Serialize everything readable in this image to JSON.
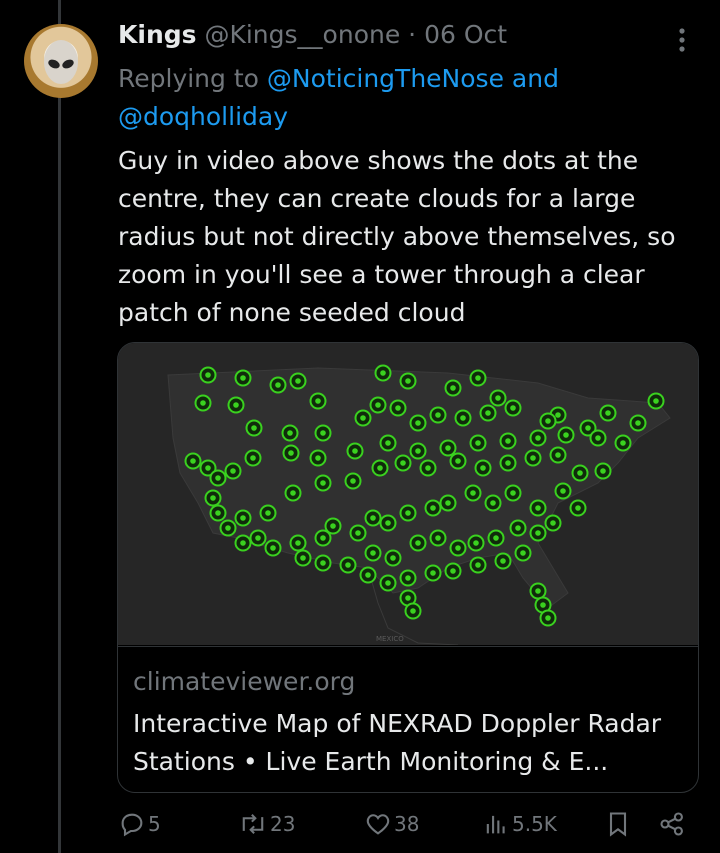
{
  "tweet": {
    "author_name": "Kings",
    "handle": "@Kings__onone",
    "separator": "·",
    "date": "06 Oct",
    "reply_prefix": "Replying to",
    "reply_mention_1": "@NoticingTheNose",
    "reply_and": "and",
    "reply_mention_2": "@doqholliday",
    "text": "Guy in video above shows the dots at the\ncentre, they can create clouds for a large\nradius but not directly above themselves, so\nzoom in you'll see a tower through a clear\npatch of none seeded cloud"
  },
  "card": {
    "domain": "climateviewer.org",
    "title": "Interactive Map of NEXRAD Doppler Radar Stations • Live Earth Monitoring & E...",
    "map_label": "MEXICO"
  },
  "actions": {
    "replies": "5",
    "reposts": "23",
    "likes": "38",
    "views": "5.5K"
  },
  "icons": [
    "more-icon",
    "reply-icon",
    "repost-icon",
    "like-icon",
    "views-icon",
    "bookmark-icon",
    "share-icon",
    "radar-marker-icon"
  ],
  "colors": {
    "background": "#000000",
    "text": "#e7e9ea",
    "muted": "#71767b",
    "link": "#1d9bf0",
    "marker": "#3ad11f"
  }
}
